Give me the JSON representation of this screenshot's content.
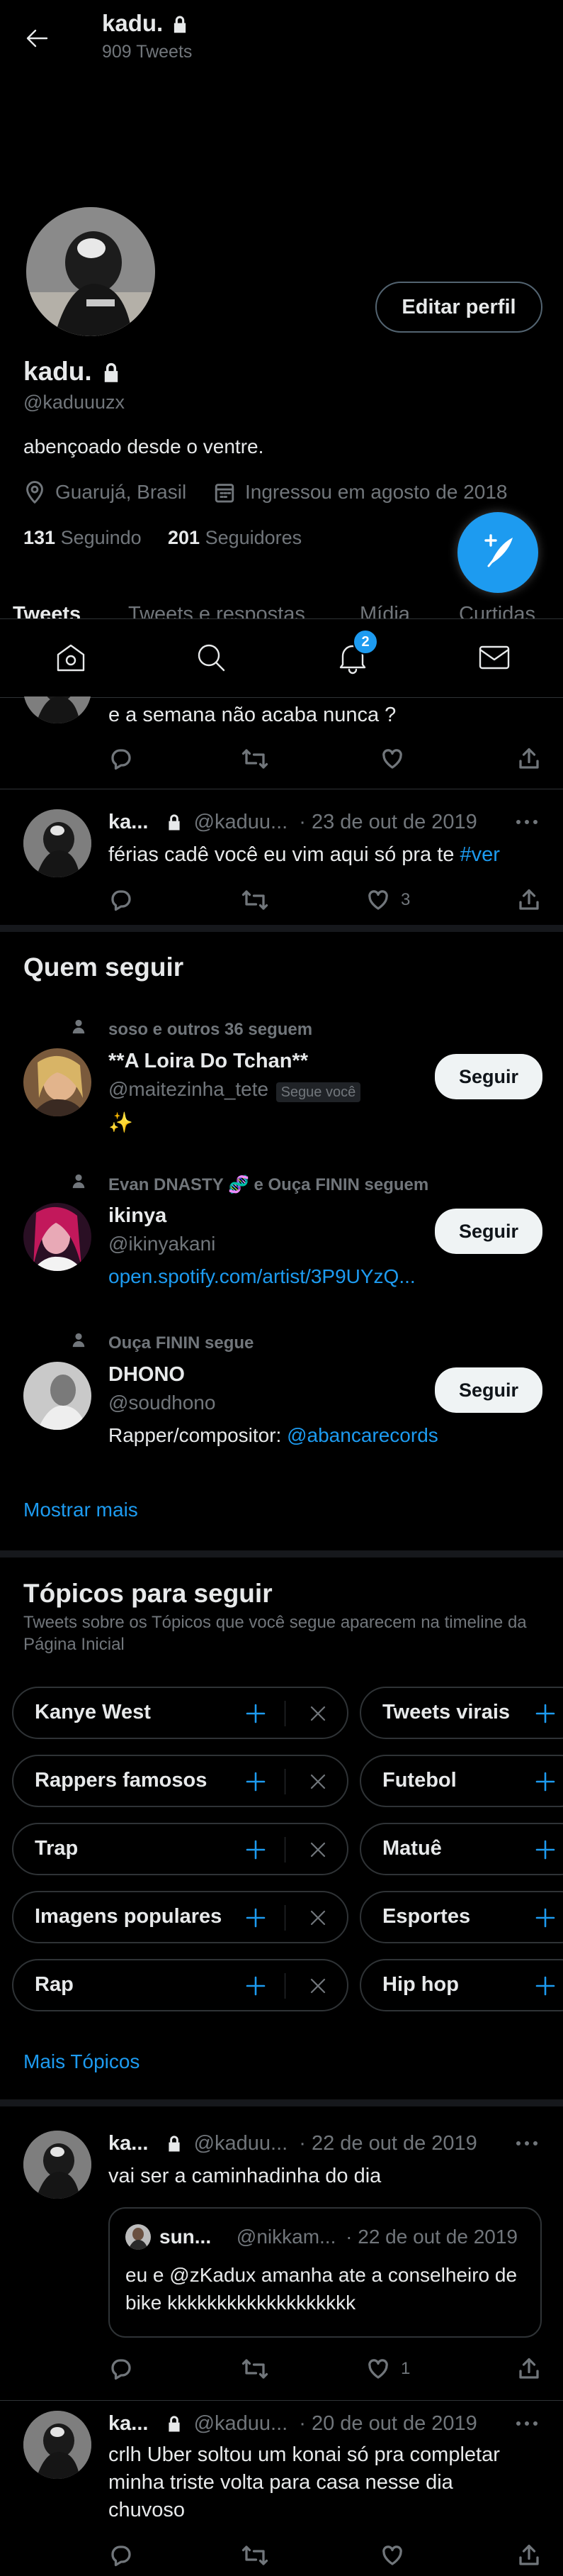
{
  "header": {
    "name": "kadu.",
    "tweet_count": "909 Tweets"
  },
  "profile": {
    "edit_button": "Editar perfil",
    "name": "kadu.",
    "handle": "@kaduuuzx",
    "bio": "abençoado desde o ventre.",
    "location": "Guarujá, Brasil",
    "joined": "Ingressou em agosto de 2018",
    "following_count": "131",
    "following_label": "Seguindo",
    "followers_count": "201",
    "followers_label": "Seguidores"
  },
  "tabs": [
    "Tweets",
    "Tweets e respostas",
    "Mídia",
    "Curtidas"
  ],
  "bottom_nav": {
    "notification_badge": "2"
  },
  "tweets": [
    {
      "text": "e a semana não acaba nunca ?"
    },
    {
      "name": "ka...",
      "handle": "@kaduu...",
      "date": "· 23 de out de 2019",
      "text": "férias cadê você eu vim aqui só pra te ",
      "hashtag": "#ver",
      "likes": "3"
    },
    {
      "name": "ka...",
      "handle": "@kaduu...",
      "date": "· 22 de out de 2019",
      "text": "vai ser a caminhadinha do dia",
      "quote": {
        "name": "sun...",
        "handle": "@nikkam...",
        "date": "· 22 de out de 2019",
        "text": "eu e @zKadux amanha ate a conselheiro de bike kkkkkkkkkkkkkkkkkkk"
      },
      "likes": "1"
    },
    {
      "name": "ka...",
      "handle": "@kaduu...",
      "date": "· 20 de out de 2019",
      "text": "crlh Uber soltou um konai só pra completar minha triste volta para casa nesse dia chuvoso"
    }
  ],
  "who_to_follow": {
    "title": "Quem seguir",
    "show_more": "Mostrar mais",
    "follow_label": "Seguir",
    "items": [
      {
        "context": "soso e outros 36 seguem",
        "name": "**A Loira Do Tchan**",
        "handle": "@maitezinha_tete",
        "follows_you": "Segue você",
        "bio": "✨"
      },
      {
        "context": "Evan DNASTY 🧬 e Ouça FININ seguem",
        "name": "ikinya",
        "handle": "@ikinyakani",
        "bio_link": "open.spotify.com/artist/3P9UYzQ..."
      },
      {
        "context": "Ouça FININ segue",
        "name": "DHONO",
        "handle": "@soudhono",
        "bio": "Rapper/compositor: ",
        "bio_mention": "@abancarecords"
      }
    ]
  },
  "topics": {
    "title": "Tópicos para seguir",
    "subtitle": "Tweets sobre os Tópicos que você segue aparecem na timeline da Página Inicial",
    "left": [
      "Kanye West",
      "Rappers famosos",
      "Trap",
      "Imagens populares",
      "Rap"
    ],
    "right": [
      "Tweets virais",
      "Futebol",
      "Matuê",
      "Esportes",
      "Hip hop"
    ],
    "more": "Mais Tópicos"
  },
  "colors": {
    "accent": "#1d9bf0",
    "background": "#000000",
    "muted": "#71767b",
    "divider": "#2f3336"
  }
}
